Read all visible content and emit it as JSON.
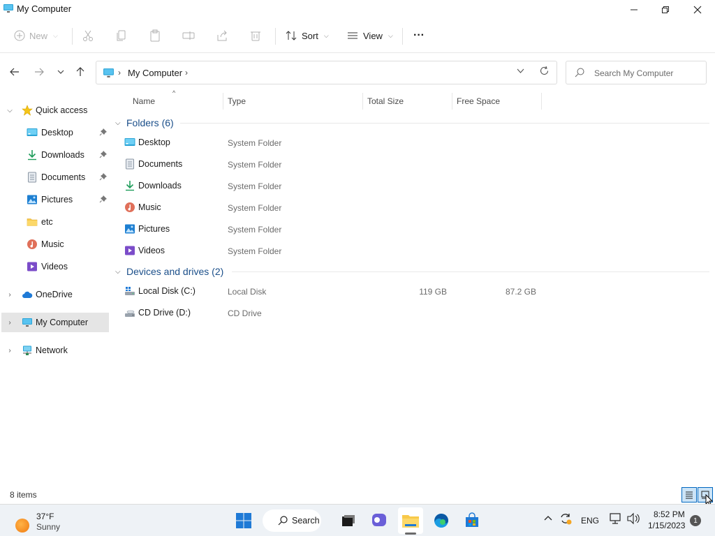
{
  "window": {
    "title": "My Computer",
    "controls": {
      "minimize": "—",
      "maximize": "❐",
      "close": "✕"
    }
  },
  "toolbar": {
    "new_label": "New",
    "sort_label": "Sort",
    "view_label": "View",
    "more_label": "···"
  },
  "address": {
    "crumb": "My Computer",
    "sep_before": "›",
    "sep_after": "›"
  },
  "search": {
    "placeholder": "Search My Computer"
  },
  "sidebar": {
    "items": [
      {
        "label": "Quick access",
        "icon": "star-icon"
      },
      {
        "label": "Desktop",
        "icon": "desktop-icon",
        "pinned": true
      },
      {
        "label": "Downloads",
        "icon": "download-icon",
        "pinned": true
      },
      {
        "label": "Documents",
        "icon": "document-icon",
        "pinned": true
      },
      {
        "label": "Pictures",
        "icon": "pictures-icon",
        "pinned": true
      },
      {
        "label": "etc",
        "icon": "folder-icon"
      },
      {
        "label": "Music",
        "icon": "music-icon"
      },
      {
        "label": "Videos",
        "icon": "videos-icon"
      },
      {
        "label": "OneDrive",
        "icon": "cloud-icon"
      },
      {
        "label": "My Computer",
        "icon": "computer-icon"
      },
      {
        "label": "Network",
        "icon": "network-icon"
      }
    ]
  },
  "columns": {
    "name": "Name",
    "type": "Type",
    "total_size": "Total Size",
    "free_space": "Free Space"
  },
  "groups": {
    "folders_title": "Folders (6)",
    "drives_title": "Devices and drives (2)"
  },
  "folders": [
    {
      "name": "Desktop",
      "type": "System Folder",
      "icon": "desktop-icon"
    },
    {
      "name": "Documents",
      "type": "System Folder",
      "icon": "document-icon"
    },
    {
      "name": "Downloads",
      "type": "System Folder",
      "icon": "download-icon"
    },
    {
      "name": "Music",
      "type": "System Folder",
      "icon": "music-icon"
    },
    {
      "name": "Pictures",
      "type": "System Folder",
      "icon": "pictures-icon"
    },
    {
      "name": "Videos",
      "type": "System Folder",
      "icon": "videos-icon"
    }
  ],
  "drives": [
    {
      "name": "Local Disk (C:)",
      "type": "Local Disk",
      "total_size": "119 GB",
      "free_space": "87.2 GB",
      "icon": "hard-drive-icon"
    },
    {
      "name": "CD Drive (D:)",
      "type": "CD Drive",
      "total_size": "",
      "free_space": "",
      "icon": "cd-drive-icon"
    }
  ],
  "status": {
    "item_count": "8 items"
  },
  "taskbar": {
    "weather_temp": "37°F",
    "weather_condition": "Sunny",
    "search_label": "Search",
    "language": "ENG",
    "time": "8:52 PM",
    "date": "1/15/2023",
    "notification_count": "1"
  },
  "colors": {
    "accent": "#0067c0",
    "group_header": "#1b4f8a",
    "selected_bg": "#e5e5e5",
    "taskbar_bg": "#eef2f6"
  }
}
